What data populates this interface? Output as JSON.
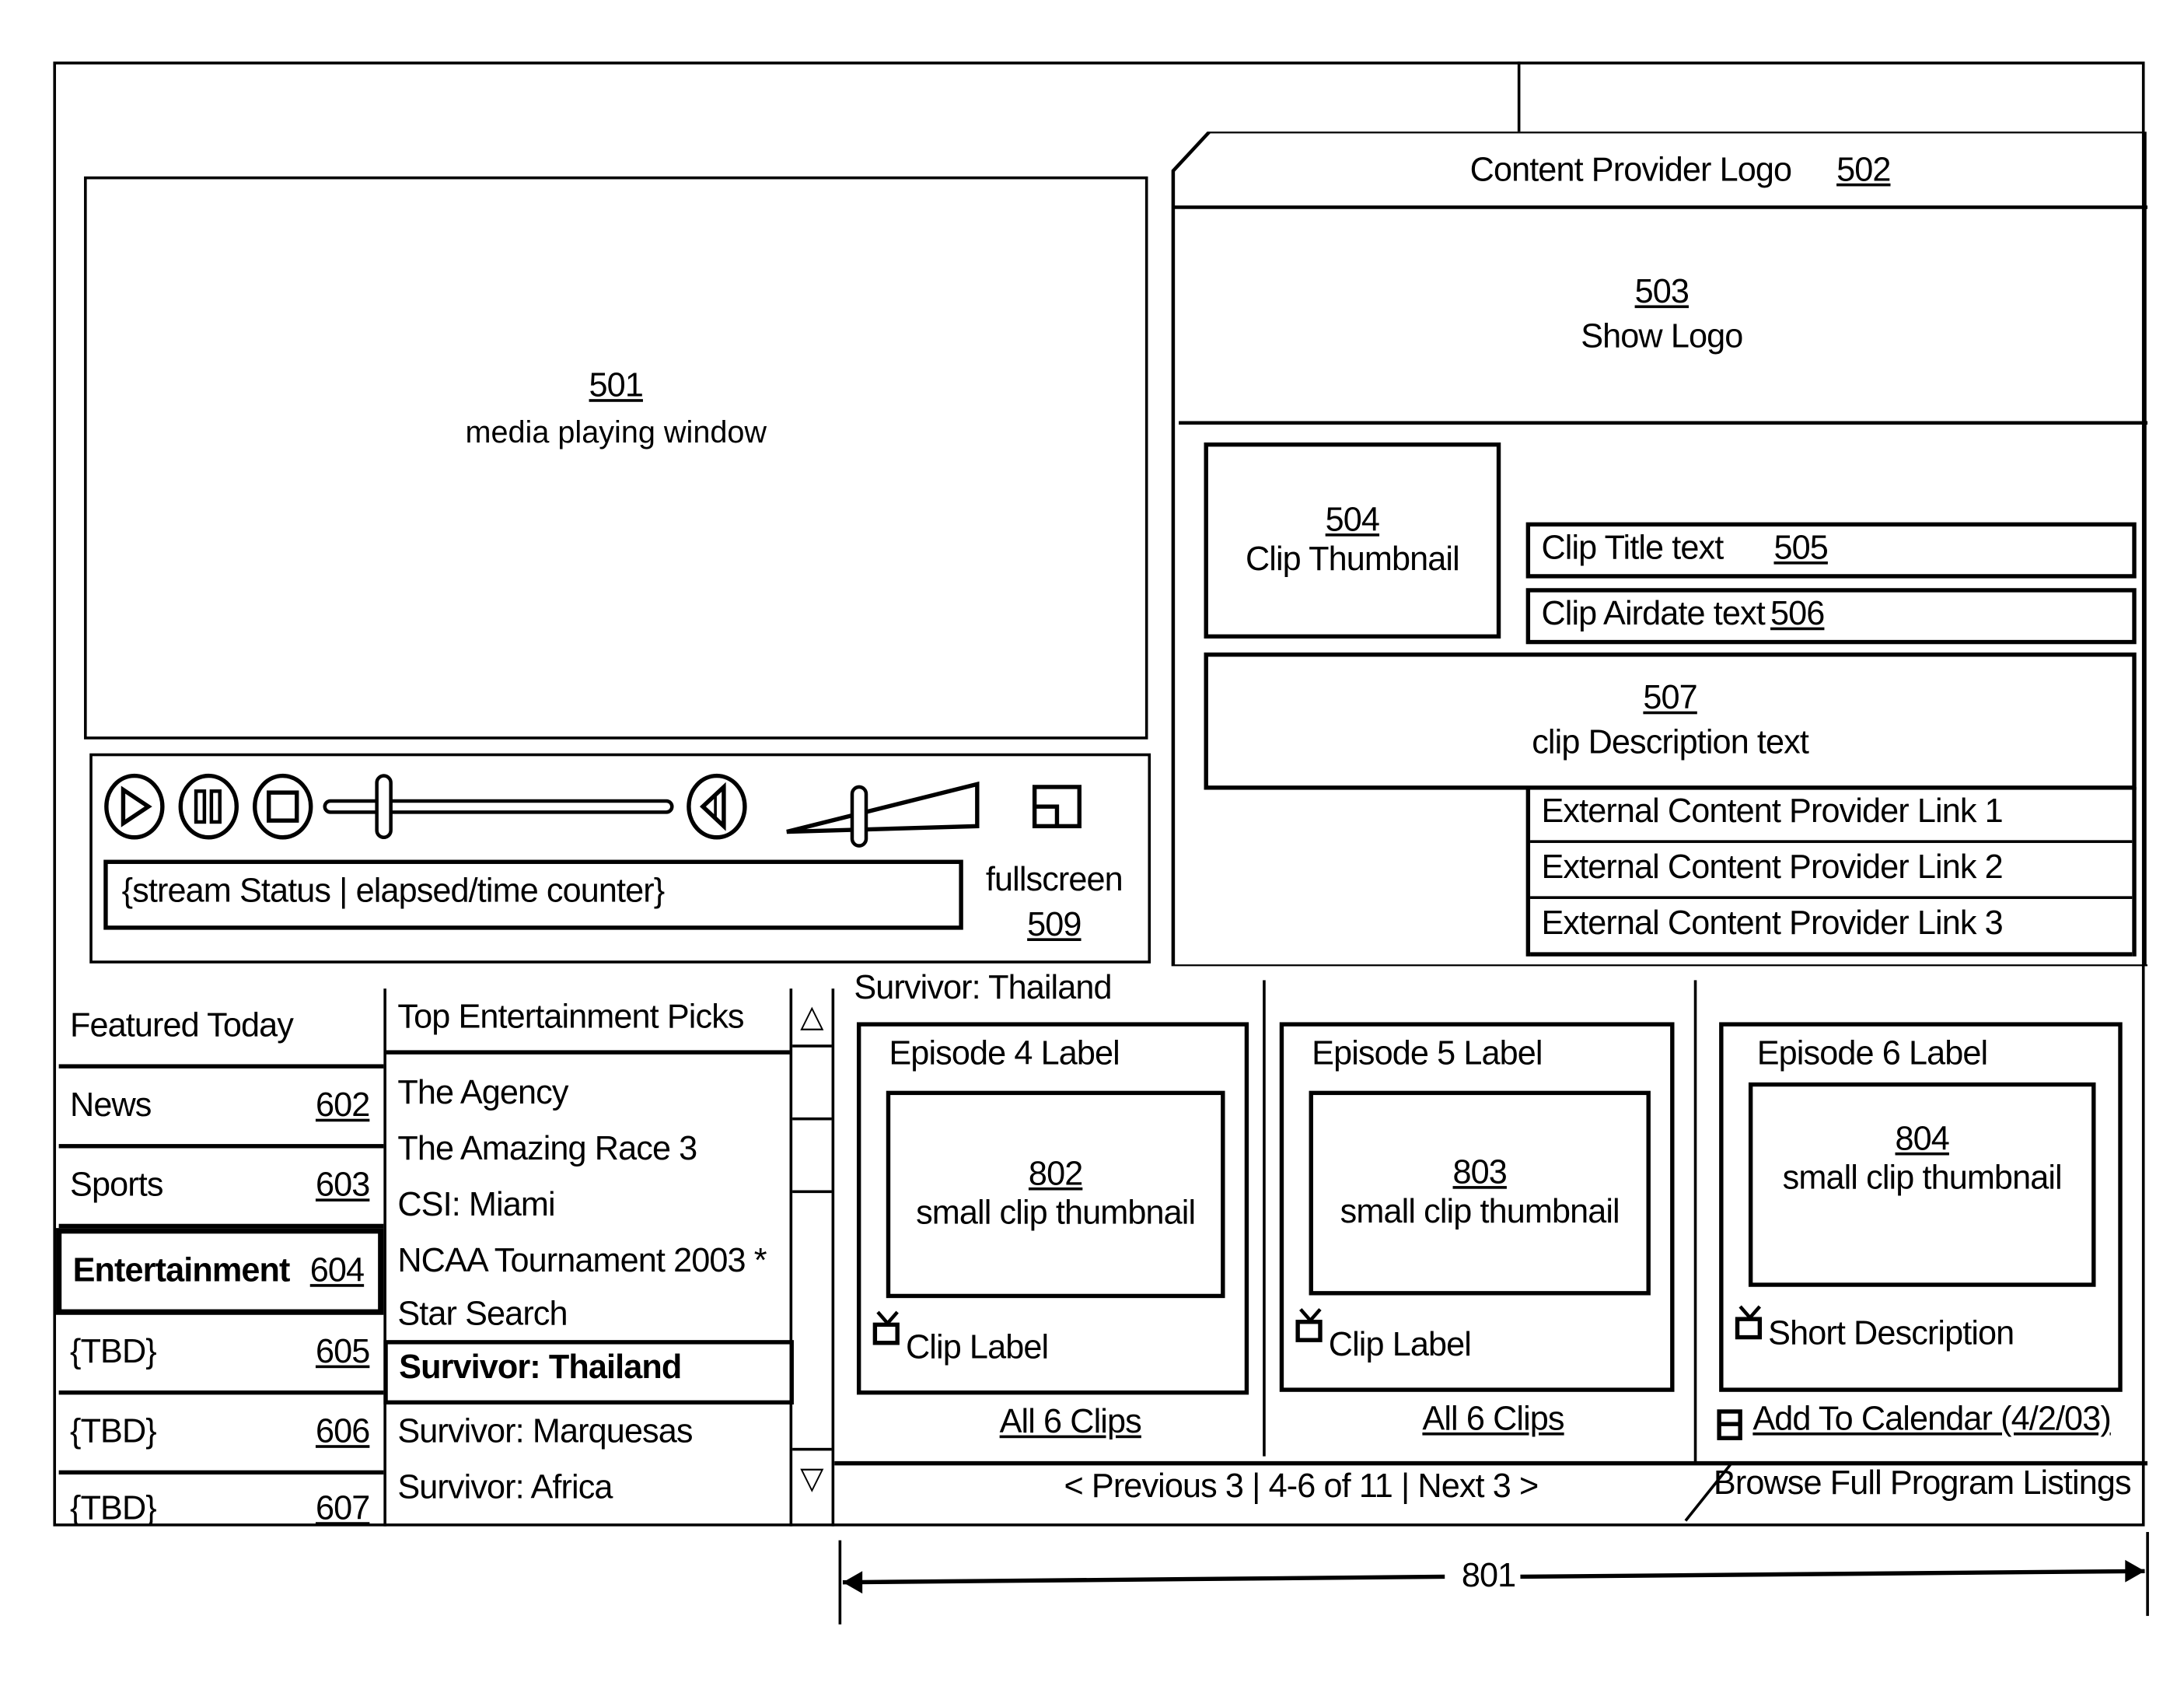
{
  "player": {
    "media_window": {
      "ref": "501",
      "label": "media playing window"
    },
    "status_text": "{stream Status | elapsed/time counter}",
    "fullscreen": {
      "label": "fullscreen",
      "ref": "509"
    },
    "controls": {
      "play": "play-icon",
      "pause": "pause-icon",
      "stop": "stop-icon",
      "mute": "speaker-icon"
    },
    "progress_fraction": 0.17,
    "volume_fraction": 0.38
  },
  "info_panel": {
    "provider_logo": {
      "label": "Content Provider Logo",
      "ref": "502"
    },
    "show_logo": {
      "ref": "503",
      "label": "Show Logo"
    },
    "clip_thumbnail": {
      "ref": "504",
      "label": "Clip Thumbnail"
    },
    "clip_title": {
      "label": "Clip Title text",
      "ref": "505"
    },
    "clip_airdate": {
      "label": "Clip Airdate text",
      "ref": "506"
    },
    "clip_description": {
      "ref": "507",
      "label": "clip Description text"
    },
    "external_links": [
      "External Content Provider Link 1",
      "External Content Provider Link 2",
      "External Content Provider Link 3"
    ]
  },
  "categories": {
    "header": "Featured Today",
    "items": [
      {
        "label": "News",
        "ref": "602"
      },
      {
        "label": "Sports",
        "ref": "603"
      },
      {
        "label": "Entertainment",
        "ref": "604",
        "selected": true
      },
      {
        "label": "{TBD}",
        "ref": "605"
      },
      {
        "label": "{TBD}",
        "ref": "606"
      },
      {
        "label": "{TBD}",
        "ref": "607"
      }
    ]
  },
  "picks": {
    "header": "Top Entertainment Picks",
    "items": [
      "The Agency",
      "The Amazing Race 3",
      "CSI: Miami",
      "NCAA Tournament 2003 *",
      "Star Search",
      "Survivor: Thailand",
      "Survivor: Marquesas",
      "Survivor: Africa"
    ],
    "selected_index": 5,
    "scroll_up": "△",
    "scroll_down": "▽"
  },
  "episodes": {
    "show_title": "Survivor: Thailand",
    "cards": [
      {
        "label": "Episode 4 Label",
        "ref": "802",
        "thumb_label": "small clip thumbnail",
        "caption": "Clip Label",
        "link": "All 6 Clips"
      },
      {
        "label": "Episode 5 Label",
        "ref": "803",
        "thumb_label": "small clip thumbnail",
        "caption": "Clip Label",
        "link": "All 6 Clips"
      },
      {
        "label": "Episode 6 Label",
        "ref": "804",
        "thumb_label": "small clip thumbnail",
        "caption": "Short Description",
        "link": "Add To Calendar (4/2/03)"
      }
    ],
    "pager": "< Previous 3 | 4-6 of 11 | Next 3 >",
    "browse_link": "Browse Full Program Listings",
    "dimension_ref": "801"
  }
}
